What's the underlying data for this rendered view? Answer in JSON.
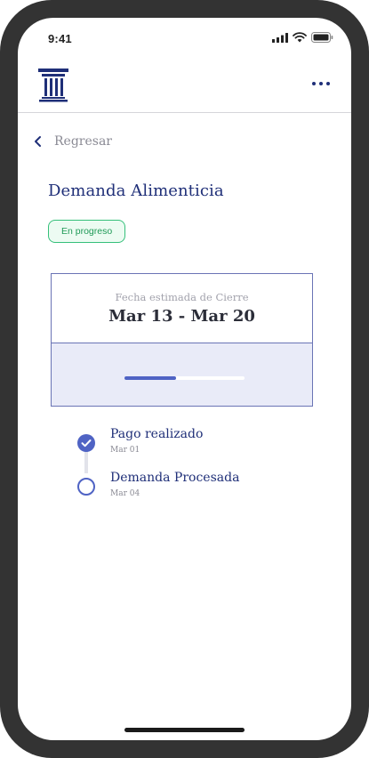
{
  "status_bar": {
    "time": "9:41"
  },
  "header": {
    "logo_icon": "column-icon",
    "menu_icon": "more-horizontal-icon"
  },
  "back": {
    "label": "Regresar",
    "icon": "chevron-left-icon"
  },
  "page": {
    "title": "Demanda Alimenticia"
  },
  "status_badge": {
    "label": "En progreso",
    "color": "#35c07a"
  },
  "closing_card": {
    "label": "Fecha estimada de Cierre",
    "date_range": "Mar 13 - Mar 20",
    "progress": 0.43
  },
  "timeline": [
    {
      "title": "Pago realizado",
      "date": "Mar 01",
      "state": "completed"
    },
    {
      "title": "Demanda Procesada",
      "date": "Mar 04",
      "state": "pending"
    }
  ],
  "colors": {
    "primary": "#1f2f78",
    "accent": "#4f63c4",
    "card_fill": "#e9ebf8",
    "success": "#35c07a"
  }
}
